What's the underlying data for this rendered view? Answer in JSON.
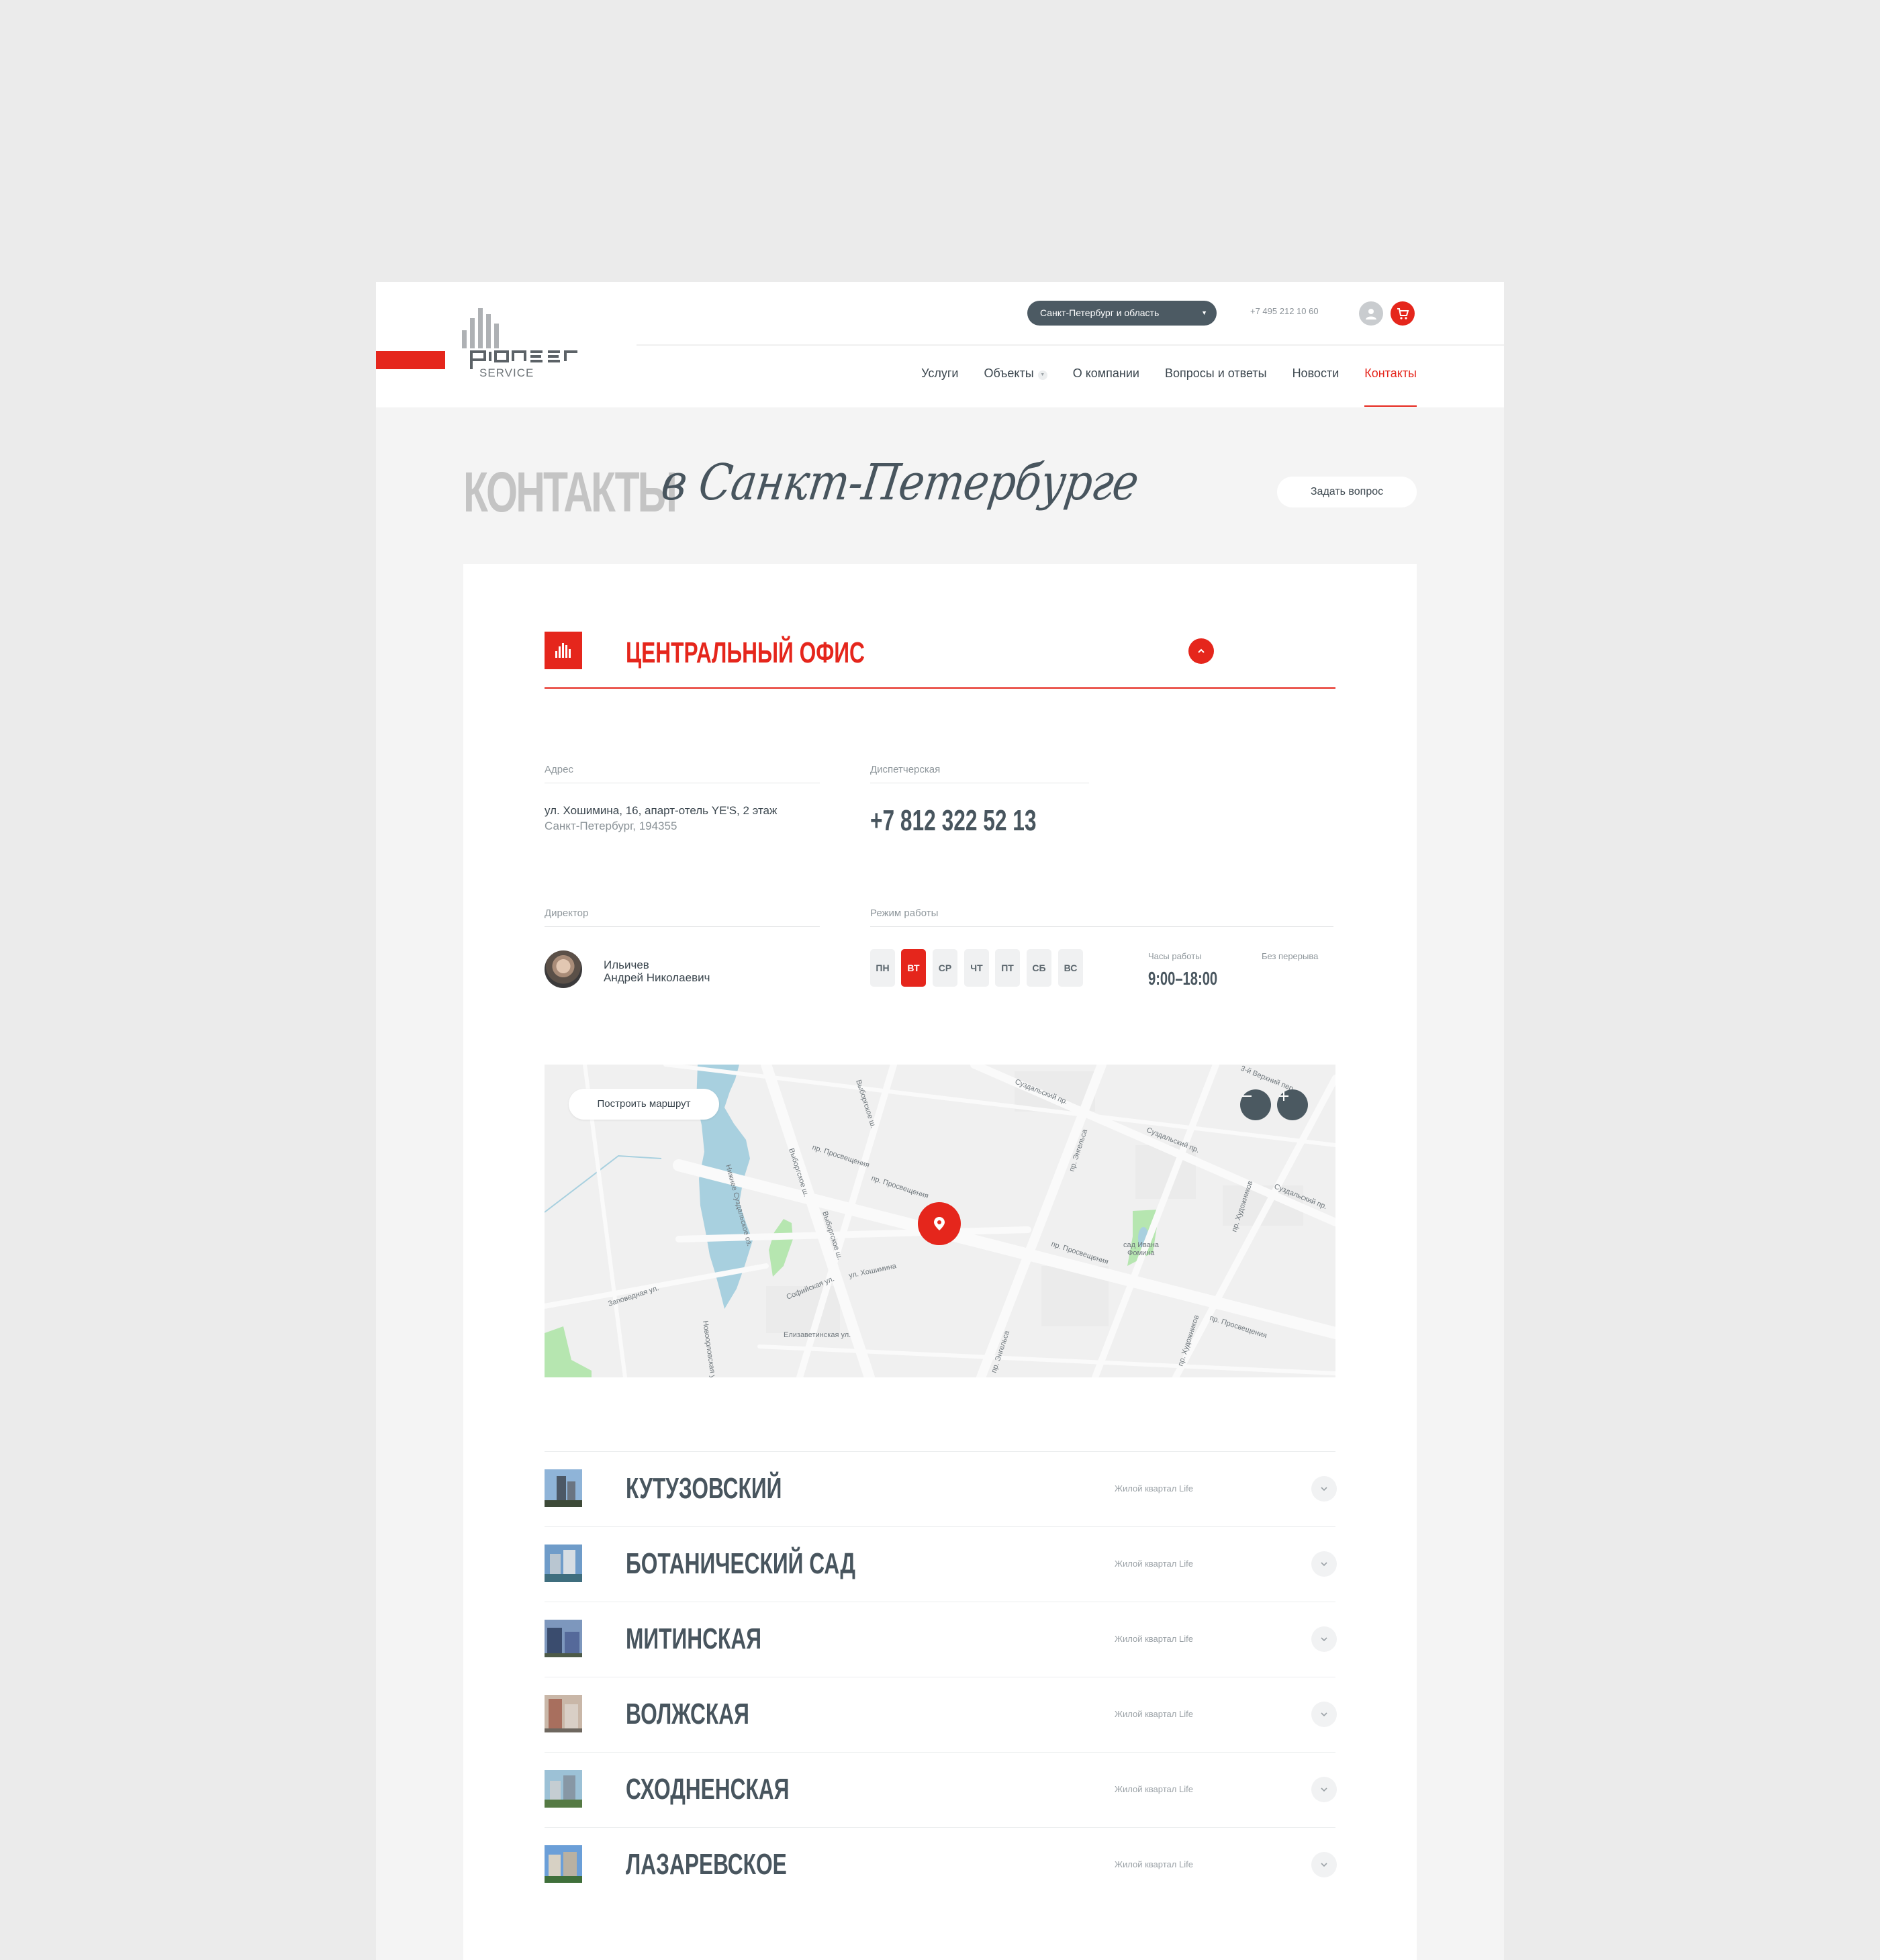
{
  "header": {
    "logo_text": "pioneer",
    "logo_sub": "SERVICE",
    "region_select": "Санкт-Петербург и область",
    "phone": "+7 495 212 10 60",
    "nav": [
      {
        "label": "Услуги"
      },
      {
        "label": "Объекты"
      },
      {
        "label": "О компании"
      },
      {
        "label": "Вопросы и ответы"
      },
      {
        "label": "Новости"
      },
      {
        "label": "Контакты"
      }
    ],
    "active_nav": "Контакты",
    "icons": [
      "user-icon",
      "cart-icon"
    ]
  },
  "page": {
    "title": "КОНТАКТЫ",
    "title_script": "в Санкт-Петербурге",
    "ask_button": "Задать вопрос"
  },
  "office": {
    "title": "ЦЕНТРАЛЬНЫЙ ОФИС",
    "address_label": "Адрес",
    "address_line1": "ул. Хошимина, 16, апарт-отель YE'S, 2 этаж",
    "address_line2": "Санкт-Петербург, 194355",
    "dispatch_label": "Диспетчерская",
    "dispatch_phone": "+7 812 322 52 13",
    "director_label": "Директор",
    "director_name1": "Ильичев",
    "director_name2": "Андрей Николаевич",
    "schedule_label": "Режим работы",
    "days": [
      {
        "label": "ПН",
        "selected": false
      },
      {
        "label": "ВТ",
        "selected": true
      },
      {
        "label": "СР",
        "selected": false
      },
      {
        "label": "ЧТ",
        "selected": false
      },
      {
        "label": "ПТ",
        "selected": false
      },
      {
        "label": "СБ",
        "selected": false
      },
      {
        "label": "ВС",
        "selected": false
      }
    ],
    "hours_label": "Часы работы",
    "hours_value": "9:00–18:00",
    "break_label": "Без перерыва"
  },
  "map": {
    "route_button": "Построить маршрут",
    "labels": {
      "lake": "Нижнее Суздальское оз.",
      "park_line1": "сад Ивана",
      "park_line2": "Фомина",
      "street_khoshimina": "ул. Хошимина",
      "street_prosv1": "пр. Просвещения",
      "street_prosv2": "пр. Просвещения",
      "street_prosv3": "пр. Просвещения",
      "street_prosv4": "пр. Просвещения",
      "street_suzd1": "Суздальский пр.",
      "street_suzd2": "Суздальский пр.",
      "street_suzd3": "Суздальский пр.",
      "street_vyborg1": "Выборгское ш.",
      "street_vyborg2": "Выборгское ш.",
      "street_vyborg3": "Выборгское ш.",
      "street_zapovednaya": "Заповедная ул.",
      "street_sofiyskaya": "Софийская ул.",
      "street_elizavet": "Елизаветинская ул.",
      "street_engelsa1": "пр. Энгельса",
      "street_engelsa2": "пр. Энгельса",
      "street_khudozh1": "пр. Художников",
      "street_khudozh2": "пр. Художников",
      "street_novoorl": "Новоорловская ул.",
      "street_verkhniy": "3-й Верхний пер."
    },
    "colors": {
      "water": "#a8d0df",
      "park": "#b6e6b0",
      "road": "#fafafa"
    }
  },
  "objects": [
    {
      "title": "КУТУЗОВСКИЙ",
      "subtitle": "Жилой квартал Life"
    },
    {
      "title": "БОТАНИЧЕСКИЙ САД",
      "subtitle": "Жилой квартал Life"
    },
    {
      "title": "МИТИНСКАЯ",
      "subtitle": "Жилой квартал Life"
    },
    {
      "title": "ВОЛЖСКАЯ",
      "subtitle": "Жилой квартал Life"
    },
    {
      "title": "СХОДНЕНСКАЯ",
      "subtitle": "Жилой квартал Life"
    },
    {
      "title": "ЛАЗАРЕВСКОЕ",
      "subtitle": "Жилой квартал Life"
    }
  ],
  "colors": {
    "accent": "#e5261c",
    "dark": "#48555e",
    "bg": "#f4f4f4"
  }
}
